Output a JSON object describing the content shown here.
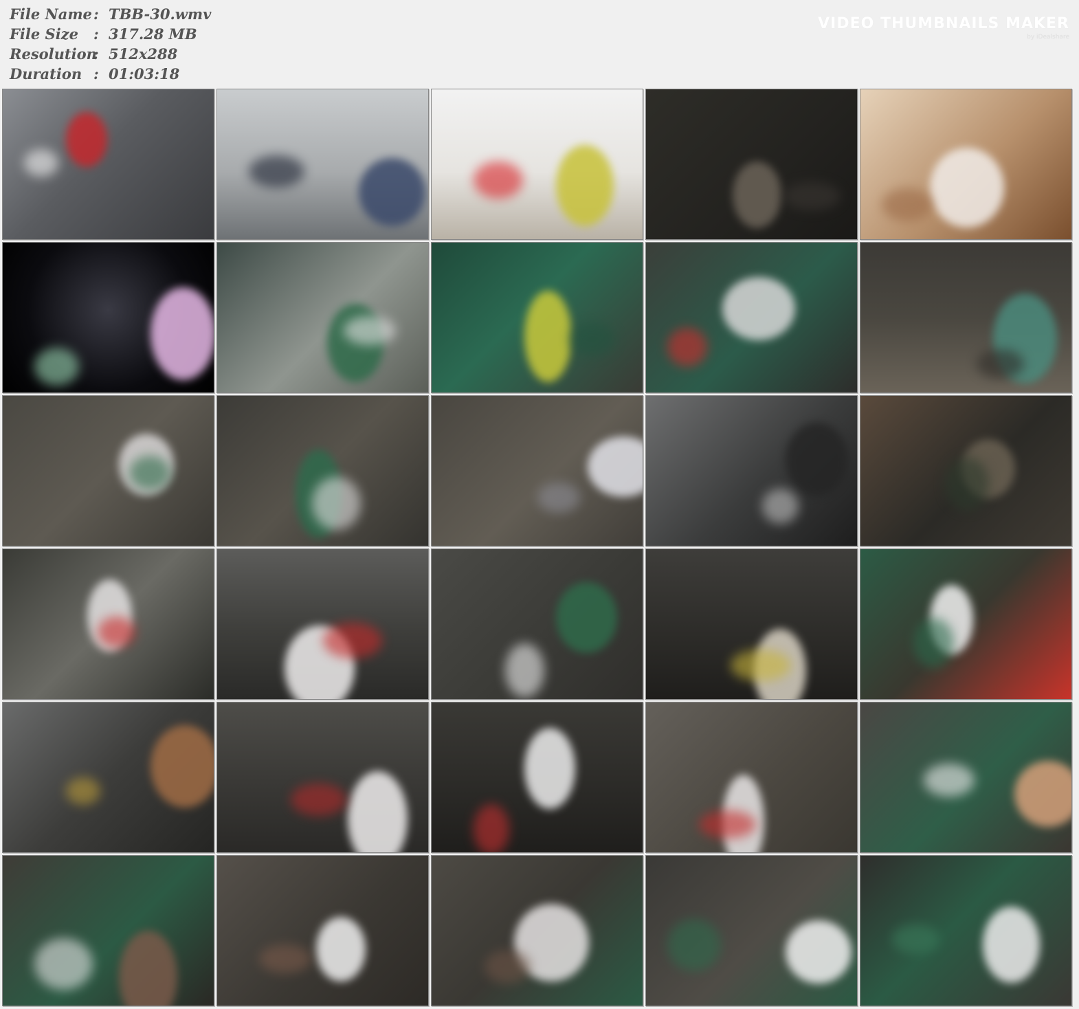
{
  "file_info": [
    {
      "label": "File Name",
      "value": "TBB-30.wmv"
    },
    {
      "label": "File Size",
      "value": "317.28 MB"
    },
    {
      "label": "Resolution",
      "value": "512x288"
    },
    {
      "label": "Duration",
      "value": "01:03:18"
    }
  ],
  "separator": ":",
  "watermark": {
    "title": "VIDEO THUMBNAILS MAKER",
    "subtitle": "by iDealshare"
  },
  "thumbnails": [
    {
      "bg": "linear-gradient(135deg,#8b8e93 0%,#5a5c60 45%,#3a3b3e 100%)",
      "accent": "#c4282d",
      "accent2": "#f4f4f4"
    },
    {
      "bg": "linear-gradient(180deg,#c9ccce 0%,#a8abad 55%,#6e7275 100%)",
      "accent": "#3b4a6b",
      "accent2": "#1e2433"
    },
    {
      "bg": "linear-gradient(180deg,#f2f2f2 0%,#e6e4e0 55%,#b9b2a6 100%)",
      "accent": "#c8c23a",
      "accent2": "#d9262b"
    },
    {
      "bg": "linear-gradient(135deg,#2e2d28 0%,#23221f 60%,#1a1917 100%)",
      "accent": "#6b6358",
      "accent2": "#3a3632"
    },
    {
      "bg": "linear-gradient(135deg,#e6d2b9 0%,#b7906c 55%,#7a4f2e 100%)",
      "accent": "#f1ece8",
      "accent2": "#9b6a47"
    },
    {
      "bg": "radial-gradient(circle at 50% 45%,#3a3a44 0%,#0b0b0f 60%,#000 100%)",
      "accent": "#e6b8e6",
      "accent2": "#9bd7b4"
    },
    {
      "bg": "linear-gradient(135deg,#3d4a46 0%,#8f958f 55%,#5b5f58 100%)",
      "accent": "#2f6b4a",
      "accent2": "#e3e3e3"
    },
    {
      "bg": "linear-gradient(135deg,#1f4a3a 0%,#2b6a52 45%,#3a3b35 100%)",
      "accent": "#c9c93b",
      "accent2": "#23523f"
    },
    {
      "bg": "linear-gradient(135deg,#3b3f3a 0%,#2c5b4a 55%,#2d2d2b 100%)",
      "accent": "#d7d7d7",
      "accent2": "#cf2c2c"
    },
    {
      "bg": "linear-gradient(180deg,#3c3a36 0%,#4a4740 50%,#6a6358 100%)",
      "accent": "#4b8a7c",
      "accent2": "#2e2c28"
    },
    {
      "bg": "linear-gradient(135deg,#4a4842 0%,#5e5a52 50%,#3a3833 100%)",
      "accent": "#d8d6d6",
      "accent2": "#2f6b4a"
    },
    {
      "bg": "linear-gradient(135deg,#3c3b37 0%,#57534b 50%,#34332f 100%)",
      "accent": "#2e6a4c",
      "accent2": "#e0e0e0"
    },
    {
      "bg": "linear-gradient(135deg,#494640 0%,#625d54 55%,#413e39 100%)",
      "accent": "#e2e2e8",
      "accent2": "#8d8d95"
    },
    {
      "bg": "linear-gradient(135deg,#6e6f70 0%,#3b3c3c 55%,#1e1e1e 100%)",
      "accent": "#252525",
      "accent2": "#bfbfbf"
    },
    {
      "bg": "linear-gradient(135deg,#5a4a3c 0%,#2b2a26 55%,#3f3a33 100%)",
      "accent": "#6a6152",
      "accent2": "#2d3a2c"
    },
    {
      "bg": "linear-gradient(135deg,#3a3b36 0%,#6a6a64 50%,#2b2c28 100%)",
      "accent": "#e3e1e1",
      "accent2": "#c92a2a"
    },
    {
      "bg": "linear-gradient(180deg,#5c5c5a 0%,#3e3e3b 55%,#2a2a28 100%)",
      "accent": "#f0eeee",
      "accent2": "#c62a2a"
    },
    {
      "bg": "linear-gradient(135deg,#4a4a46 0%,#3b3b37 55%,#2f2e2b 100%)",
      "accent": "#2f6a4a",
      "accent2": "#eeeeee"
    },
    {
      "bg": "linear-gradient(180deg,#3e3d3a 0%,#2c2b28 60%,#1f1e1c 100%)",
      "accent": "#d9d2c3",
      "accent2": "#c8b43a"
    },
    {
      "bg": "linear-gradient(135deg,#2c5b45 0%,#39382f 50%,#c8332a 100%)",
      "accent": "#f1f1f1",
      "accent2": "#2b6a4c"
    },
    {
      "bg": "linear-gradient(135deg,#6a6b6b 0%,#3d3d3b 50%,#252523 100%)",
      "accent": "#a06c45",
      "accent2": "#b99a3a"
    },
    {
      "bg": "linear-gradient(180deg,#4e4d49 0%,#3b3a37 50%,#2a2927 100%)",
      "accent": "#f0eeee",
      "accent2": "#b02a2a"
    },
    {
      "bg": "linear-gradient(180deg,#3a3935 0%,#2c2b28 55%,#1f1e1c 100%)",
      "accent": "#ededed",
      "accent2": "#c43030"
    },
    {
      "bg": "linear-gradient(135deg,#64605a 0%,#4c4841 55%,#3a3731 100%)",
      "accent": "#e9e6e6",
      "accent2": "#c42c2c"
    },
    {
      "bg": "linear-gradient(135deg,#4a4744 0%,#2f5e48 55%,#3b3631 100%)",
      "accent": "#d5a07a",
      "accent2": "#f1f1f1"
    },
    {
      "bg": "linear-gradient(135deg,#3f3c37 0%,#2c5a44 55%,#2a2824 100%)",
      "accent": "#7a5a4a",
      "accent2": "#e5e5e5"
    },
    {
      "bg": "linear-gradient(135deg,#55504a 0%,#3b3833 55%,#2d2a26 100%)",
      "accent": "#f0f0f0",
      "accent2": "#7a5a4a"
    },
    {
      "bg": "linear-gradient(135deg,#4d4a44 0%,#3a3833 50%,#2b5a44 100%)",
      "accent": "#e5e2e2",
      "accent2": "#6d5446"
    },
    {
      "bg": "linear-gradient(135deg,#3a3936 0%,#4f4c46 55%,#2b5943 100%)",
      "accent": "#f0f0f0",
      "accent2": "#2f6a4c"
    },
    {
      "bg": "linear-gradient(135deg,#2f2e2c 0%,#2b5a44 45%,#3a3834 100%)",
      "accent": "#ececec",
      "accent2": "#3a7a5a"
    }
  ]
}
